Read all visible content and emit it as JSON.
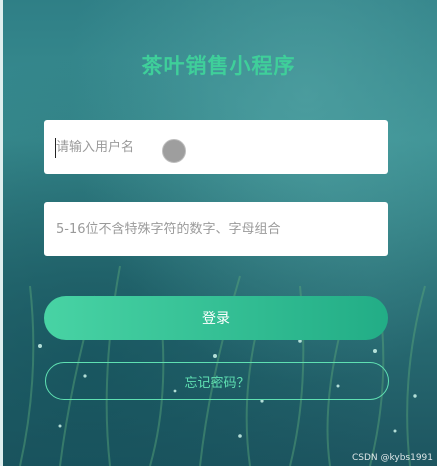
{
  "app": {
    "title": "茶叶销售小程序"
  },
  "login_form": {
    "username_placeholder": "请输入用户名",
    "username_value": "",
    "password_placeholder": "5-16位不含特殊字符的数字、字母组合",
    "password_value": "",
    "login_label": "登录",
    "forgot_label": "忘记密码？"
  },
  "watermark": {
    "text": "CSDN @kybs1991"
  },
  "colors": {
    "accent": "#3fcf9a",
    "button_gradient_start": "#48d3a4",
    "button_gradient_end": "#22ad86",
    "outline": "#5fe0b2"
  },
  "icons": [
    "cursor-indicator"
  ]
}
